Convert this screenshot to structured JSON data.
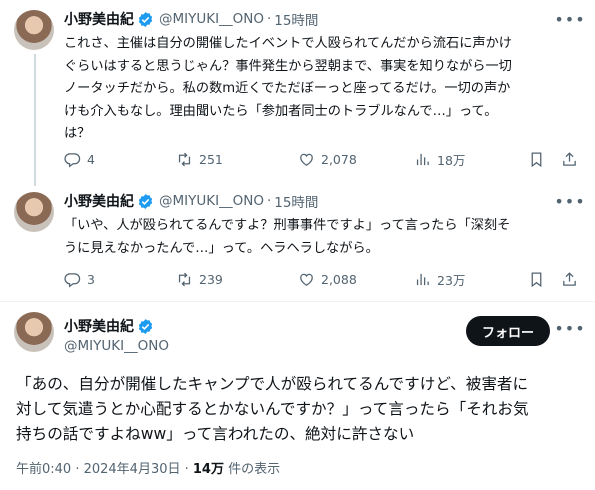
{
  "thread": [
    {
      "name": "小野美由紀",
      "handle": "@MIYUKI__ONO",
      "dot": "·",
      "time": "15時間",
      "lines": [
        "これさ、主催は自分の開催したイベントで人殴られてんだから流石に声かけ",
        "ぐらいはすると思うじゃん？事件発生から翌朝まで、事実を知りながら一切",
        "ノータッチだから。私の数m近くでただぼーっと座ってるだけ。一切の声か",
        "けも介入もなし。理由聞いたら「参加者同士のトラブルなんで…」って。",
        "は？"
      ],
      "stats": {
        "replies": "4",
        "reposts": "251",
        "likes": "2,078",
        "views": "18万"
      }
    },
    {
      "name": "小野美由紀",
      "handle": "@MIYUKI__ONO",
      "dot": "·",
      "time": "15時間",
      "lines": [
        "「いや、人が殴られてるんですよ？刑事事件ですよ」って言ったら「深刻そ",
        "うに見えなかったんで…」って。ヘラヘラしながら。"
      ],
      "stats": {
        "replies": "3",
        "reposts": "239",
        "likes": "2,088",
        "views": "23万"
      }
    }
  ],
  "main": {
    "name": "小野美由紀",
    "handle": "@MIYUKI__ONO",
    "follow_label": "フォロー",
    "lines": [
      "「あの、自分が開催したキャンプで人が殴られてるんですけど、被害者に",
      "対して気遣うとか心配するとかないんですか？」って言ったら「それお気",
      "持ちの話ですよねww」って言われたの、絶対に許さない"
    ],
    "timestamp": "午前0:40 · 2024年4月30日 · ",
    "views_count": "14万",
    "views_label": " 件の表示"
  },
  "colors": {
    "text": "#0f1419",
    "secondary": "#536471",
    "verified": "#1d9bf0",
    "button": "#0f1419"
  },
  "icons": [
    "verified-badge-icon",
    "more-icon",
    "reply-icon",
    "repost-icon",
    "like-icon",
    "views-icon",
    "bookmark-icon",
    "share-icon"
  ]
}
